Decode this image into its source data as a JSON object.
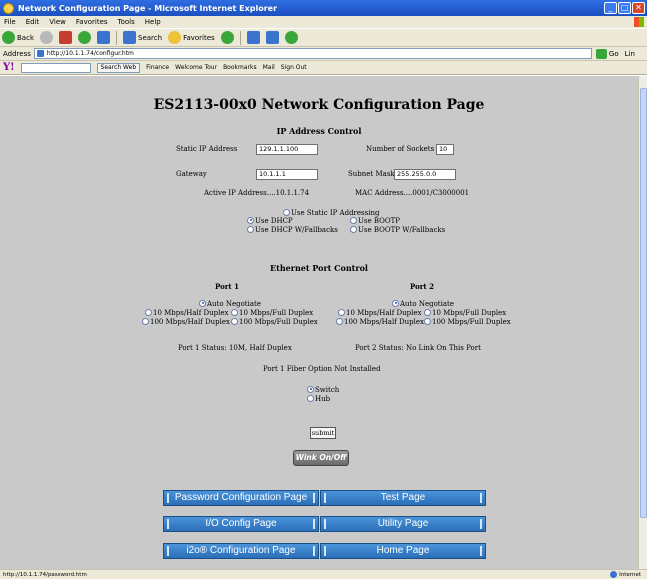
{
  "window": {
    "title": "Network Configuration Page - Microsoft Internet Explorer",
    "controls": [
      "_",
      "□",
      "✕"
    ]
  },
  "menu": [
    "File",
    "Edit",
    "View",
    "Favorites",
    "Tools",
    "Help"
  ],
  "toolbar": {
    "back": "Back",
    "search": "Search",
    "favorites": "Favorites"
  },
  "address": {
    "label": "Address",
    "url": "http://10.1.1.74/configur.htm",
    "go": "Go",
    "links": "Lin"
  },
  "yahoo": {
    "logo": "Y!",
    "search_web": "Search Web",
    "finance": "Finance",
    "welcome_tour": "Welcome Tour",
    "bookmarks": "Bookmarks",
    "mail": "Mail",
    "sign_out": "Sign Out"
  },
  "page": {
    "title": "ES2113-00x0 Network Configuration Page",
    "ip_section": {
      "heading": "IP Address Control",
      "static_ip_label": "Static IP Address",
      "static_ip_value": "129.1.1.100",
      "sockets_label": "Number of Sockets",
      "sockets_value": "10",
      "gateway_label": "Gateway",
      "gateway_value": "10.1.1.1",
      "subnet_label": "Subnet Mask",
      "subnet_value": "255.255.0.0",
      "active_ip": "Active IP Address....10.1.1.74",
      "mac": "MAC Address....0001/C3000001",
      "modes": {
        "static": "Use Static IP Addressing",
        "dhcp": "Use DHCP",
        "bootp": "Use BOOTP",
        "dhcp_fallback": "Use DHCP W/Fallbacks",
        "bootp_fallback": "Use BOOTP W/Fallbacks"
      }
    },
    "ethernet_section": {
      "heading": "Ethernet Port Control",
      "port1": "Port 1",
      "port2": "Port 2",
      "auto": "Auto Negotiate",
      "m10_half": "10 Mbps/Half Duplex",
      "m10_full": "10 Mbps/Full Duplex",
      "m100_half": "100 Mbps/Half Duplex",
      "m100_full": "100 Mbps/Full Duplex",
      "port1_status": "Port 1 Status: 10M, Half Duplex",
      "port2_status": "Port 2 Status: No Link On This Port",
      "fiber": "Port 1 Fiber Option Not Installed",
      "switch": "Switch",
      "hub": "Hub"
    },
    "submit": "submit",
    "wink": "Wink On/Off",
    "nav": {
      "password": "Password Configuration Page",
      "test": "Test Page",
      "io": "I/O Config Page",
      "utility": "Utility Page",
      "i2o": "i2o® Configuration Page",
      "home": "Home Page"
    }
  },
  "status": {
    "text": "http://10.1.1.74/password.htm",
    "zone": "Internet"
  },
  "colors": {
    "page_bg": "#c9c9c9",
    "nav_button": "#3a82c8",
    "titlebar": "#2459d0"
  }
}
